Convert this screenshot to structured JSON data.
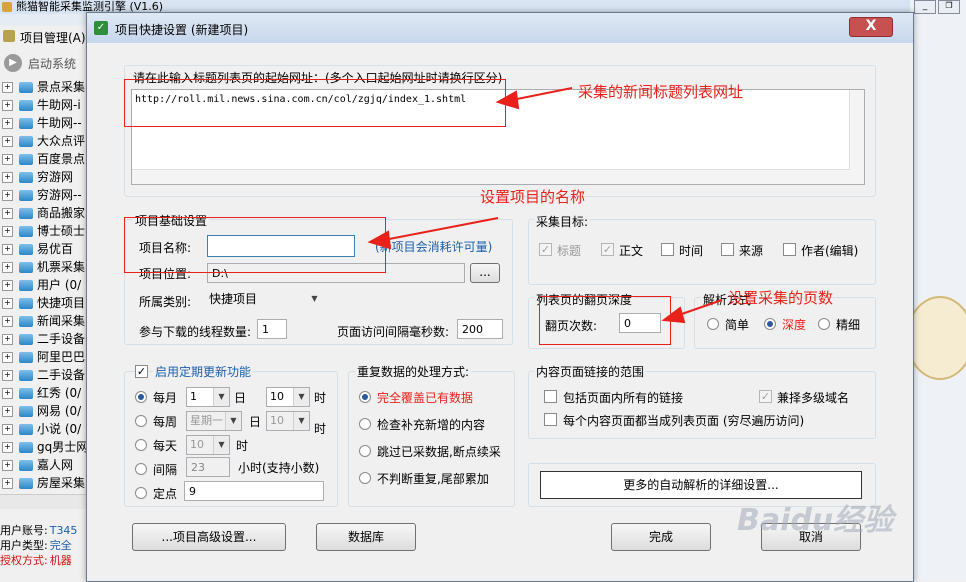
{
  "app": {
    "title": "熊猫智能采集监测引擎 (V1.6)",
    "menu_item": "项目管理(A)",
    "toolbar_start": "启动系统",
    "tree_items": [
      "景点采集",
      "牛助网-i",
      "牛助网--",
      "大众点评",
      "百度景点",
      "穷游网",
      "穷游网--",
      "商品搬家",
      "博士硕士",
      "易优百",
      "机票采集",
      "用户 (0/",
      "快捷项目",
      "新闻采集",
      "二手设备",
      "阿里巴巴",
      "二手设备",
      "红秀 (0/",
      "网易 (0/",
      "小说 (0/",
      "gq男士网",
      "嘉人网",
      "房屋采集"
    ],
    "status": {
      "account_label": "用户账号:",
      "account_value": "T345",
      "type_label": "用户类型:",
      "type_value": "完全",
      "auth_label": "授权方式:",
      "auth_value": "机器"
    }
  },
  "dialog": {
    "title": "项目快捷设置 (新建项目)",
    "close_label": "X",
    "url_section_label": "请在此输入标题列表页的起始网址：(多个入口起始网址时请换行区分)",
    "start_url": "http://roll.mil.news.sina.com.cn/col/zgjq/index_1.shtml",
    "basic": {
      "group_label": "项目基础设置",
      "name_label": "项目名称:",
      "name_value": "",
      "license_note": "(新项目会消耗许可量)",
      "location_label": "项目位置:",
      "location_value": "D:\\",
      "browse_label": "...",
      "category_label": "所属类别:",
      "category_value": "快捷项目",
      "threads_label": "参与下载的线程数量:",
      "threads_value": "1",
      "interval_label": "页面访问间隔毫秒数:",
      "interval_value": "200"
    },
    "targets": {
      "group_label": "采集目标:",
      "items": [
        {
          "label": "标题",
          "checked": true,
          "disabled": true
        },
        {
          "label": "正文",
          "checked": true,
          "disabled": true
        },
        {
          "label": "时间",
          "checked": false,
          "disabled": false
        },
        {
          "label": "来源",
          "checked": false,
          "disabled": false
        },
        {
          "label": "作者(编辑)",
          "checked": false,
          "disabled": false
        }
      ]
    },
    "paging": {
      "group_label": "列表页的翻页深度",
      "count_label": "翻页次数:",
      "count_value": "0"
    },
    "parse": {
      "group_label": "解析方式",
      "options": [
        {
          "label": "简单",
          "selected": false
        },
        {
          "label": "深度",
          "selected": true
        },
        {
          "label": "精细",
          "selected": false
        }
      ]
    },
    "schedule": {
      "group_label": "启用定期更新功能",
      "enabled": true,
      "monthly_label": "每月",
      "monthly_day": "1",
      "day_unit": "日",
      "monthly_hour": "10",
      "hour_unit": "时",
      "weekly_label": "每周",
      "weekly_day": "星期一",
      "weekly_day_unit": "日",
      "weekly_hour": "10",
      "weekly_hour_unit": "时",
      "daily_label": "每天",
      "daily_hour": "10",
      "daily_hour_unit": "时",
      "interval_label": "间隔",
      "interval_value": "23",
      "interval_unit": "小时(支持小数)",
      "fixed_label": "定点",
      "fixed_value": "9"
    },
    "duplicate": {
      "group_label": "重复数据的处理方式:",
      "options": [
        {
          "label": "完全覆盖已有数据",
          "selected": true
        },
        {
          "label": "检查补充新增的内容",
          "selected": false
        },
        {
          "label": "跳过已采数据,断点续采",
          "selected": false
        },
        {
          "label": "不判断重复,尾部累加",
          "selected": false
        }
      ]
    },
    "links": {
      "group_label": "内容页面链接的范围",
      "all_links": "包括页面内所有的链接",
      "multi_domain": "兼择多级域名",
      "as_list": "每个内容页面都当成列表页面 (穷尽遍历访问)"
    },
    "more_settings": "更多的自动解析的详细设置...",
    "buttons": {
      "advanced": "...项目高级设置...",
      "database": "数据库",
      "finish": "完成",
      "cancel": "取消"
    }
  },
  "annotations": {
    "url_note": "采集的新闻标题列表网址",
    "name_note": "设置项目的名称",
    "pages_note": "设置采集的页数"
  },
  "watermark": "Baidu经验",
  "colors": {
    "annotation": "#e8221a",
    "radio_selected_text": "#e8221a",
    "titlebar": "#c6d7ec",
    "close_button": "#c75050"
  }
}
